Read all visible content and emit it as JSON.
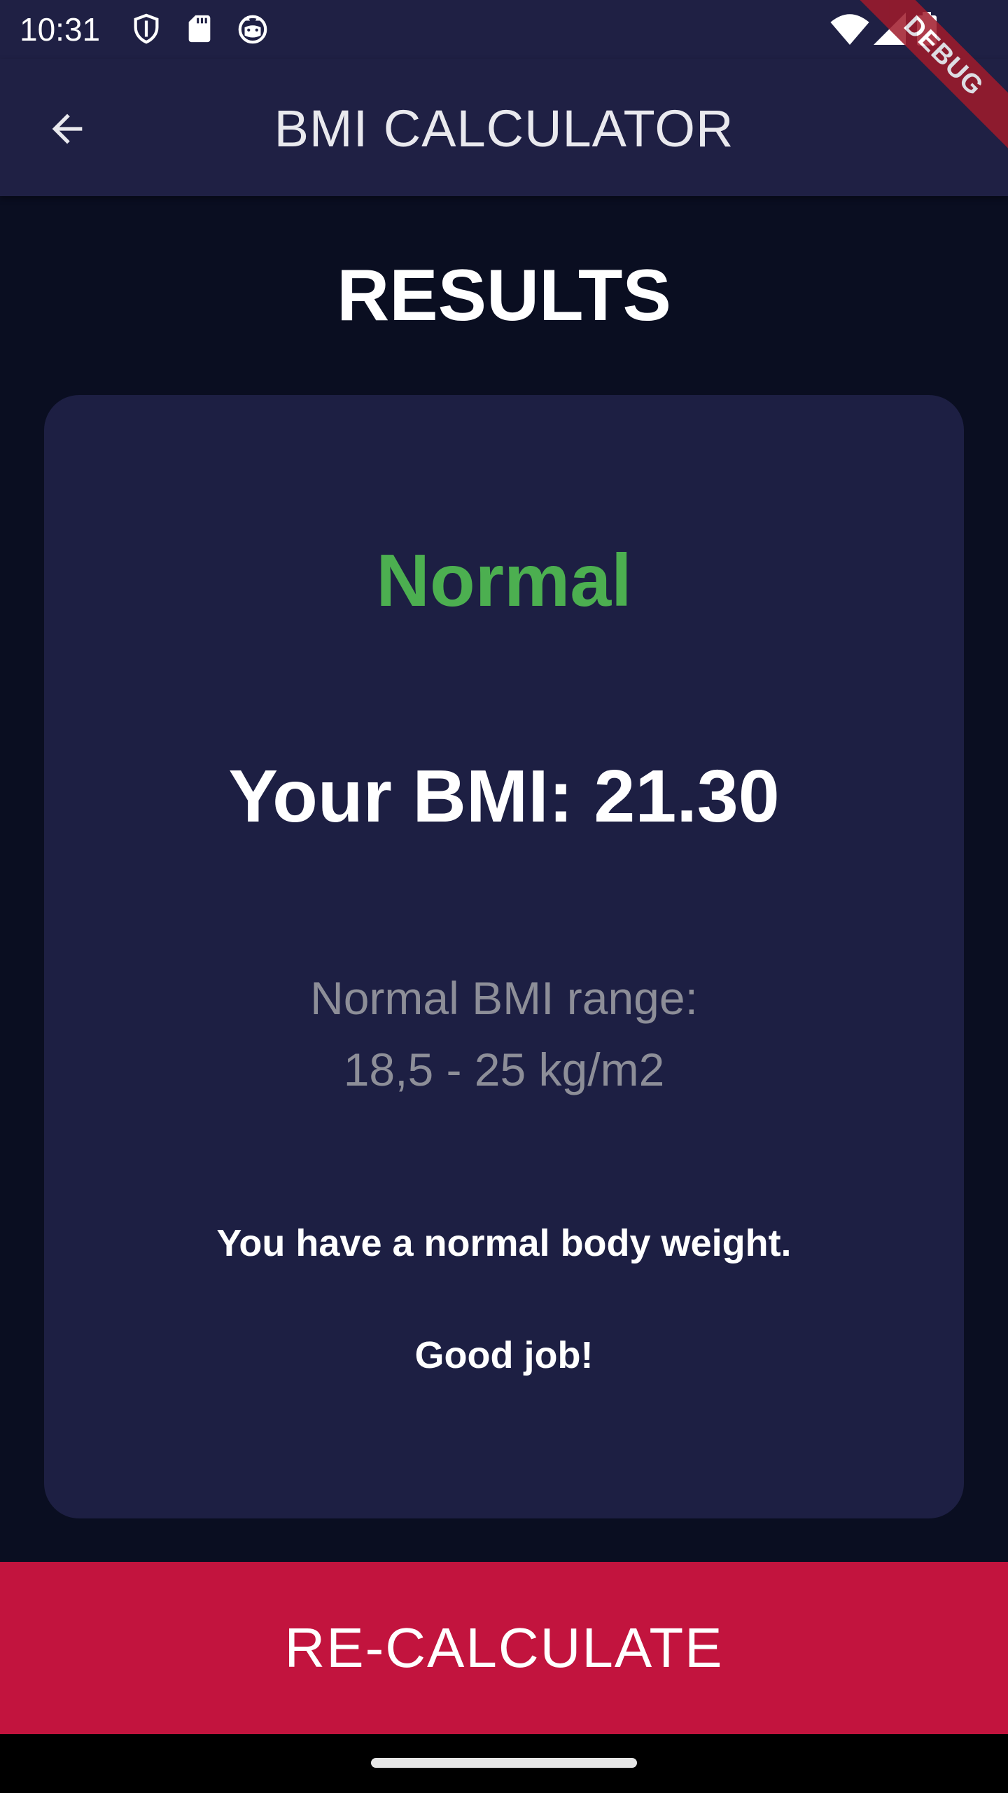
{
  "status_bar": {
    "time": "10:31",
    "left_icons": [
      "shield-icon",
      "sd-card-icon",
      "cat-face-icon"
    ],
    "right_icons": [
      "wifi-icon",
      "cell-signal-icon",
      "battery-icon"
    ]
  },
  "app_bar": {
    "title": "BMI CALCULATOR",
    "back_icon": "arrow-back-icon",
    "debug_banner": "DEBUG"
  },
  "results": {
    "heading": "RESULTS",
    "status": "Normal",
    "status_color": "#4caf50",
    "bmi_text": "Your BMI: 21.30",
    "range_line1": "Normal BMI range:",
    "range_line2": "18,5 - 25 kg/m2",
    "message_line1": "You have a normal body weight.",
    "message_line2": "Good job!"
  },
  "bottom_button": {
    "label": "RE-CALCULATE",
    "color": "#c2143e"
  }
}
